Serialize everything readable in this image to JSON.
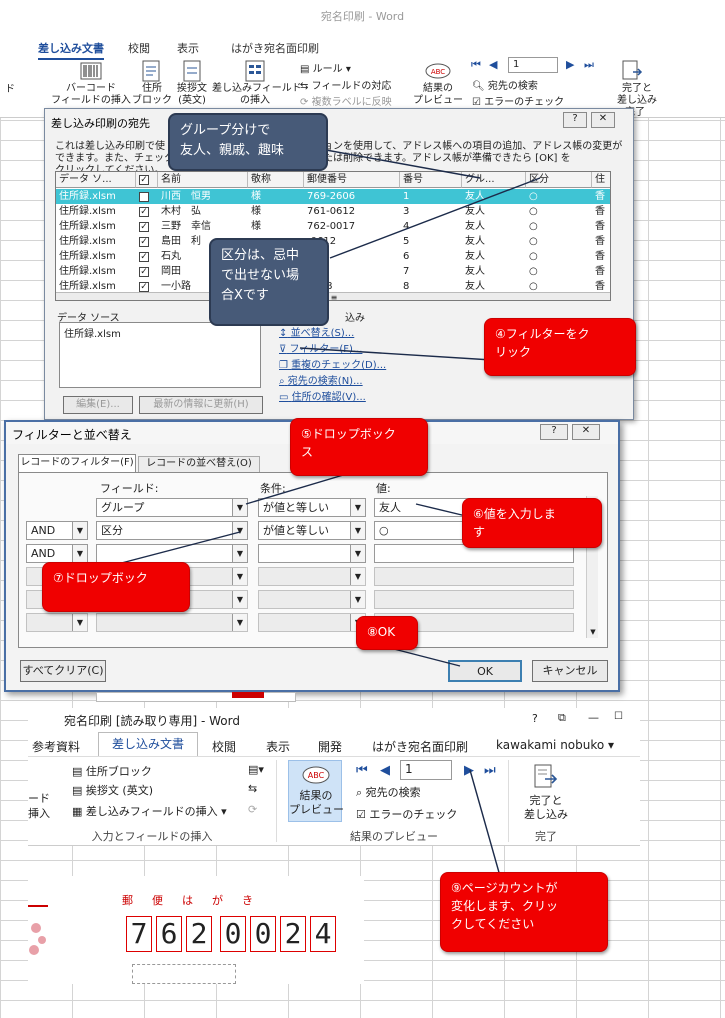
{
  "top_ribbon": {
    "window_title": "宛名印刷 - Word",
    "tabs": [
      "差し込み文書",
      "校閲",
      "表示",
      "はがき宛名面印刷"
    ],
    "buttons": {
      "cut_label": "ド",
      "barcode": "バーコード\nフィールドの挿入",
      "address_block": "住所\nブロック",
      "greeting": "挨拶文\n(英文)",
      "insert_merge_field": "差し込みフィールド\nの挿入",
      "rules": "ルール",
      "match_fields": "フィールドの対応",
      "update_labels": "複数ラベルに反映",
      "preview_results": "結果の\nプレビュー",
      "record_number": "1",
      "find_recipient": "宛先の検索",
      "check_errors": "エラーのチェック",
      "finish_merge": "完了と\n差し込み",
      "finish_group": "完了"
    }
  },
  "dialog_recipients": {
    "title": "差し込み印刷の宛先",
    "help": "?",
    "close": "✕",
    "description_left": "これは差し込み印刷で使",
    "description_right": "ションを使用して、アドレス帳への項目の追加、アドレス帳の変更が",
    "description_line2_left": "できます。また、チェック ボ",
    "description_line2_right": "または削除できます。アドレス帳が準備できたら [OK] を",
    "description_line3": "クリックしてください。",
    "columns": [
      "データ ソ...",
      "",
      "名前",
      "敬称",
      "郵便番号",
      "番号",
      "グル...",
      "区分",
      "住"
    ],
    "rows": [
      {
        "source": "住所録.xlsm",
        "checked": true,
        "name": "川西　恒男",
        "honorific": "様",
        "zip": "769-2606",
        "no": "1",
        "group": "友人",
        "category": "○",
        "extra": "香"
      },
      {
        "source": "住所録.xlsm",
        "checked": true,
        "name": "木村　弘",
        "honorific": "様",
        "zip": "761-0612",
        "no": "3",
        "group": "友人",
        "category": "○",
        "extra": "香"
      },
      {
        "source": "住所録.xlsm",
        "checked": true,
        "name": "三野　幸信",
        "honorific": "様",
        "zip": "762-0017",
        "no": "4",
        "group": "友人",
        "category": "○",
        "extra": "香"
      },
      {
        "source": "住所録.xlsm",
        "checked": true,
        "name": "島田　利",
        "honorific": "",
        "zip": "-0612",
        "no": "5",
        "group": "友人",
        "category": "○",
        "extra": "香"
      },
      {
        "source": "住所録.xlsm",
        "checked": true,
        "name": "石丸",
        "honorific": "",
        "zip": "",
        "no": "6",
        "group": "友人",
        "category": "○",
        "extra": "香"
      },
      {
        "source": "住所録.xlsm",
        "checked": true,
        "name": "岡田",
        "honorific": "",
        "zip": "023",
        "no": "7",
        "group": "友人",
        "category": "○",
        "extra": "香"
      },
      {
        "source": "住所録.xlsm",
        "checked": true,
        "name": "一小路",
        "honorific": "",
        "zip": "8078",
        "no": "8",
        "group": "友人",
        "category": "○",
        "extra": "香"
      }
    ],
    "data_source_label": "データ ソース",
    "data_source_item": "住所録.xlsm",
    "edit_button": "編集(E)...",
    "refresh_button": "最新の情報に更新(H)",
    "refine_title": "込み",
    "refine_links": [
      "並べ替え(S)...",
      "フィルター(F)...",
      "重複のチェック(D)...",
      "宛先の検索(N)...",
      "住所の確認(V)..."
    ]
  },
  "dialog_filter": {
    "title": "フィルターと並べ替え",
    "help": "?",
    "close": "✕",
    "tabs": [
      "レコードのフィルター(F)",
      "レコードの並べ替え(O)"
    ],
    "col_headers": {
      "field": "フィールド:",
      "condition": "条件:",
      "value": "値:"
    },
    "rows": [
      {
        "conj": "",
        "field": "グループ",
        "condition": "が値と等しい",
        "value": "友人"
      },
      {
        "conj": "AND",
        "field": "区分",
        "condition": "が値と等しい",
        "value": "○"
      },
      {
        "conj": "AND",
        "field": "",
        "condition": "",
        "value": ""
      },
      {
        "conj": "",
        "field": "",
        "condition": "",
        "value": ""
      },
      {
        "conj": "",
        "field": "",
        "condition": "",
        "value": ""
      },
      {
        "conj": "",
        "field": "",
        "condition": "",
        "value": ""
      }
    ],
    "clear_all": "すべてクリア(C)",
    "ok": "OK",
    "cancel": "キャンセル"
  },
  "bottom_ribbon": {
    "window_title": "宛名印刷 [読み取り専用] - Word",
    "help": "?",
    "user": "kawakami nobuko",
    "tabs": [
      "参考資料",
      "差し込み文書",
      "校閲",
      "表示",
      "開発",
      "はがき宛名面印刷"
    ],
    "commands": {
      "address_block": "住所ブロック",
      "greeting": "挨拶文 (英文)",
      "insert_merge_field": "差し込みフィールドの挿入",
      "left_cut_1": "ード",
      "left_cut_2": "挿入",
      "group1": "入力とフィールドの挿入",
      "preview_results": "結果の\nプレビュー",
      "record_number": "1",
      "find_recipient": "宛先の検索",
      "check_errors": "エラーのチェック",
      "group2": "結果のプレビュー",
      "finish_merge": "完了と\n差し込み",
      "group3": "完了"
    }
  },
  "postcard": {
    "header": "郵　便　は　が　き",
    "zip_digits": [
      "7",
      "6",
      "2",
      "0",
      "0",
      "2",
      "4"
    ]
  },
  "callouts": {
    "group_info": "グループ分けで\n友人、親戚、趣味",
    "category_info": "区分は、忌中\nで出せない場\n合Xです",
    "step4": "④フィルターをク\nリック",
    "step5": "⑤ドロップボック\nス",
    "step6": "⑥値を入力しま\nす",
    "step7": "⑦ドロップボック",
    "step8": "⑧OK",
    "step9": "⑨ページカウントが\n変化します、クリッ\nクしてください"
  }
}
